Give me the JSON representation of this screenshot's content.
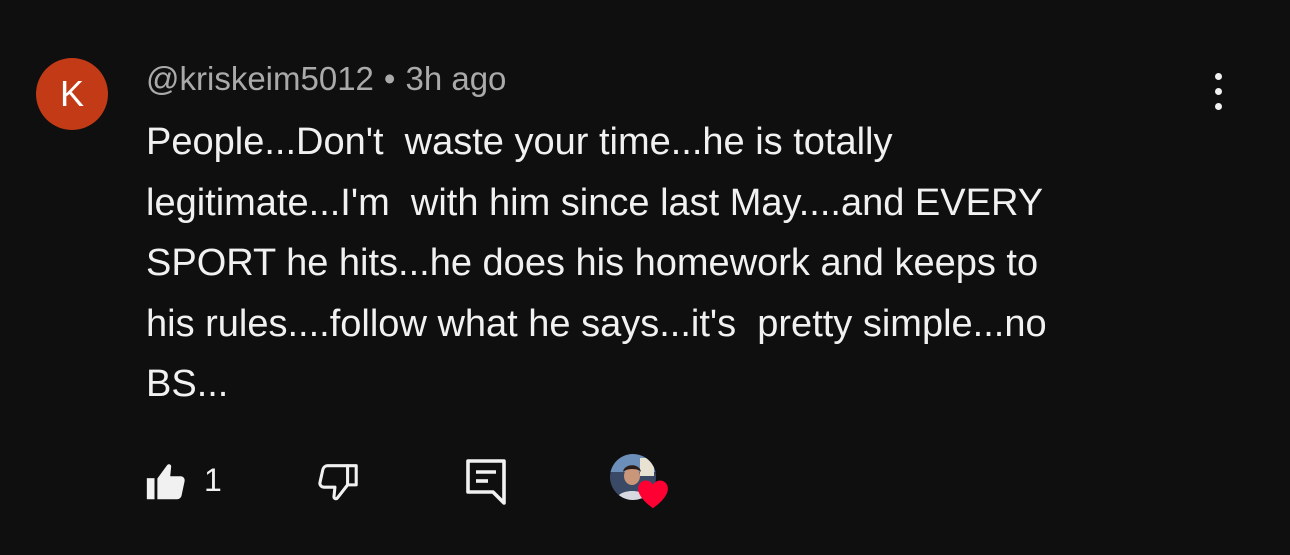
{
  "comment": {
    "avatar_letter": "K",
    "avatar_color": "#c23b16",
    "author": "@kriskeim5012",
    "separator": "•",
    "timestamp": "3h ago",
    "text": "People...Don't  waste your time...he is totally\nlegitimate...I'm  with him since last May....and EVERY\nSPORT he hits...he does his homework and keeps to\nhis rules....follow what he says...it's  pretty simple...no\nBS...",
    "menu_icon": "more-vert-icon"
  },
  "actions": {
    "like_icon": "thumbs-up-filled-icon",
    "like_count": "1",
    "dislike_icon": "thumbs-down-outline-icon",
    "reply_icon": "reply-comment-icon",
    "creator_heart_icon": "creator-heart-icon",
    "heart_color": "#ff0033"
  },
  "colors": {
    "background": "#0f0f0f",
    "primary_text": "#f1f1f1",
    "secondary_text": "#aaaaaa"
  }
}
